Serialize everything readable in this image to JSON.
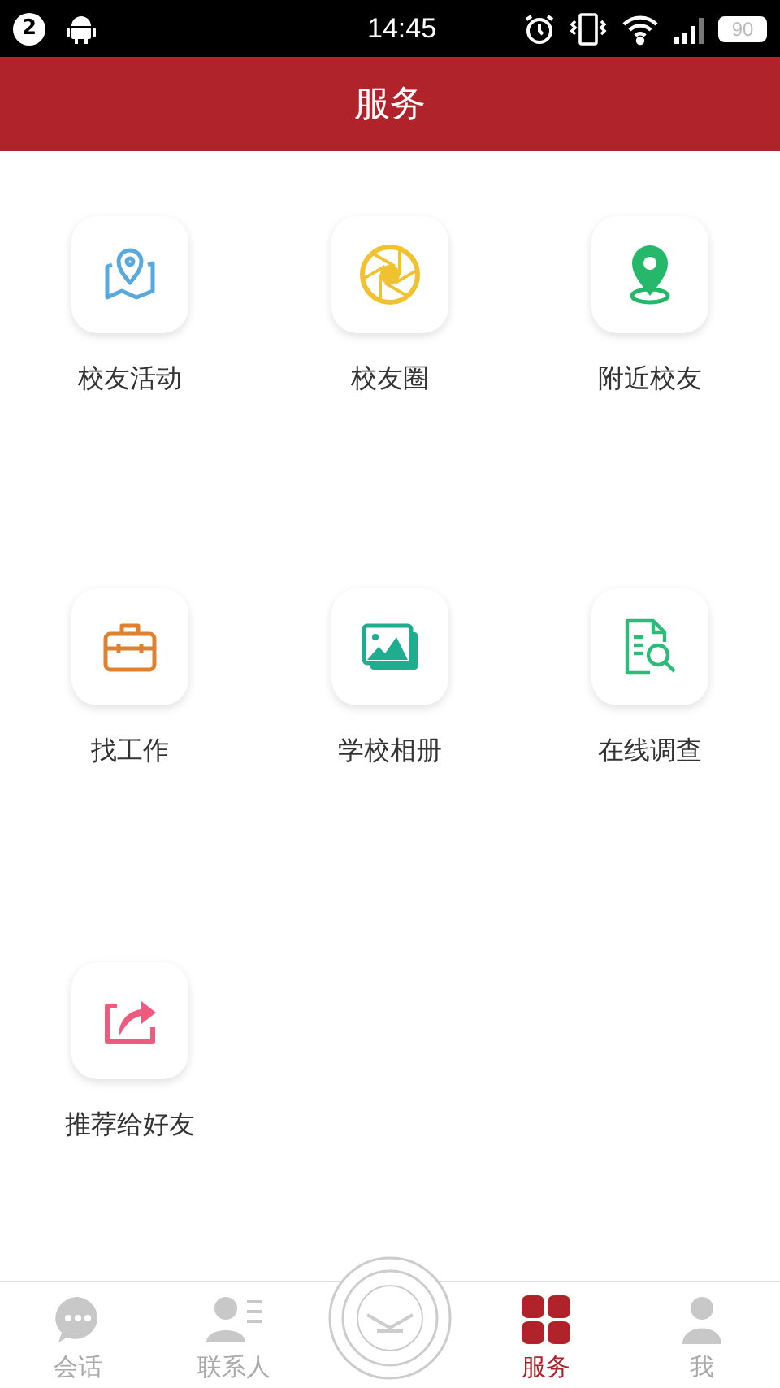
{
  "status_bar": {
    "notification_count": "2",
    "time": "14:45",
    "battery": "90"
  },
  "header": {
    "title": "服务"
  },
  "services": [
    {
      "label": "校友活动",
      "kind": "map"
    },
    {
      "label": "校友圈",
      "kind": "aperture"
    },
    {
      "label": "附近校友",
      "kind": "pin"
    },
    {
      "label": "找工作",
      "kind": "briefcase"
    },
    {
      "label": "学校相册",
      "kind": "photos"
    },
    {
      "label": "在线调查",
      "kind": "survey"
    },
    {
      "label": "推荐给好友",
      "kind": "share"
    }
  ],
  "tab_bar": [
    {
      "label": "会话",
      "kind": "chat",
      "selected": false
    },
    {
      "label": "联系人",
      "kind": "contacts",
      "selected": false
    },
    {
      "kind": "emblem"
    },
    {
      "label": "服务",
      "kind": "grid",
      "selected": true
    },
    {
      "label": "我",
      "kind": "person",
      "selected": false
    }
  ]
}
